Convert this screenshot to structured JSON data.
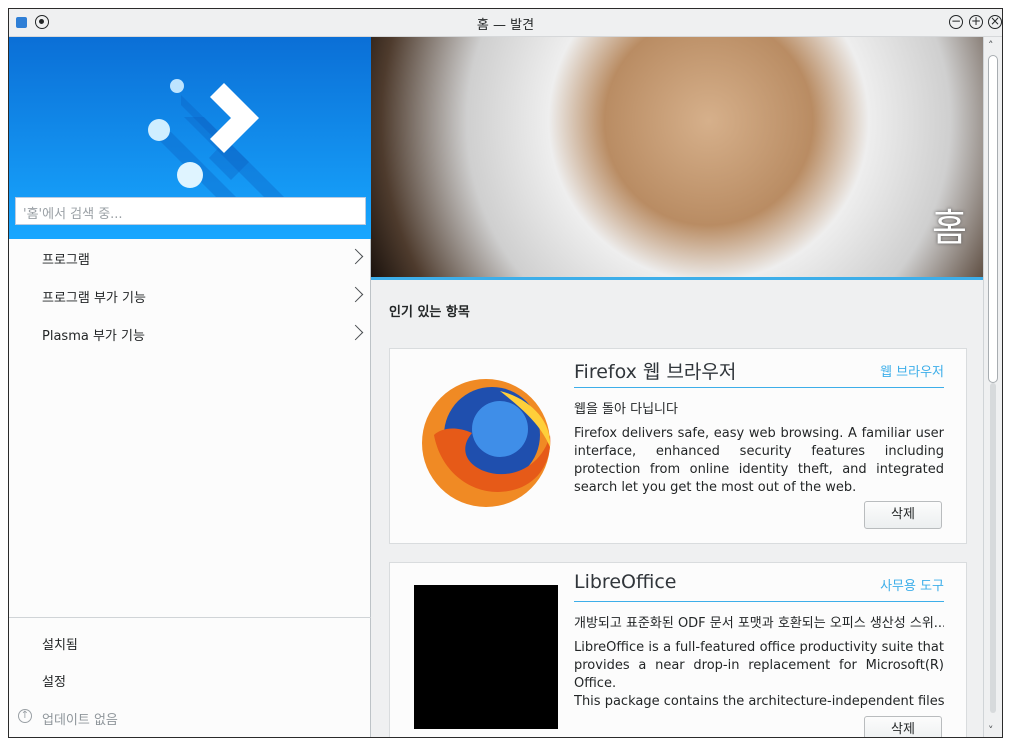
{
  "window": {
    "title": "홈 — 발견"
  },
  "sidebar": {
    "search_placeholder": "'홈'에서 검색 중...",
    "items": [
      {
        "label": "프로그램"
      },
      {
        "label": "프로그램 부가 기능"
      },
      {
        "label": "Plasma 부가 기능"
      }
    ],
    "bottom": {
      "installed": "설치됨",
      "settings": "설정",
      "updates": "업데이트 없음"
    }
  },
  "main": {
    "banner_title": "홈",
    "section_title": "인기 있는 항목",
    "cards": [
      {
        "name": "Firefox 웹 브라우저",
        "category": "웹 브라우저",
        "summary": "웹을 돌아 다닙니다",
        "description": "Firefox delivers safe, easy web browsing. A familiar user interface, enhanced security features including protection from online identity theft, and integrated search let you get the most out of the web.",
        "button": "삭제"
      },
      {
        "name": "LibreOffice",
        "category": "사무용 도구",
        "summary": "개방되고 표준화된 ODF 문서 포맷과 호환되는 오피스 생산성 스위...",
        "description": "LibreOffice is a full-featured office productivity suite that provides a near drop-in replacement for Microsoft(R) Office.",
        "description2": "This package contains the architecture-independent files o...",
        "button": "삭제"
      }
    ]
  },
  "colors": {
    "accent": "#3daee9",
    "hero_top": "#0b6fd6",
    "hero_bottom": "#18a7ff"
  },
  "icons": {
    "app": "discover-icon",
    "pin": "pin-icon",
    "minimize": "minimize-icon",
    "maximize": "maximize-icon",
    "close": "close-icon",
    "update": "update-icon",
    "chevron": "chevron-right-icon"
  }
}
